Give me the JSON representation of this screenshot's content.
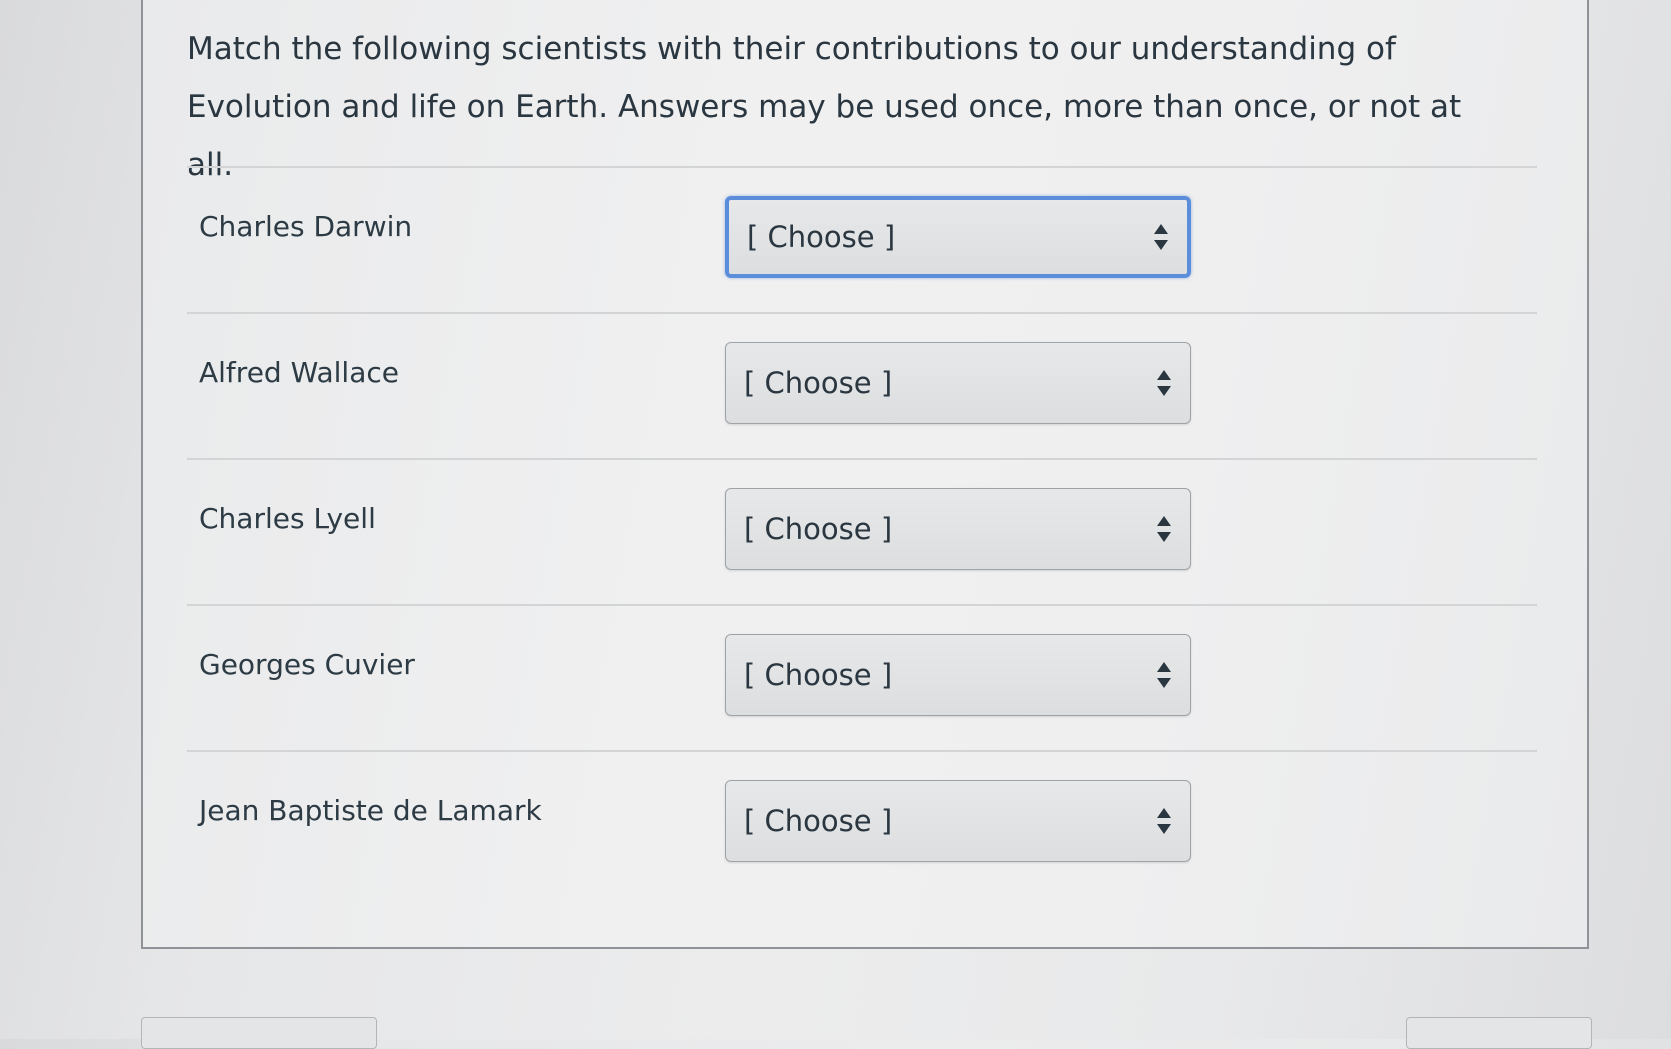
{
  "question": {
    "text": "Match the following scientists with their contributions to our understanding of Evolution and life on Earth.  Answers may be used once, more than once, or not at all."
  },
  "rows": [
    {
      "term": "Charles Darwin",
      "selected": "[ Choose ]"
    },
    {
      "term": "Alfred Wallace",
      "selected": "[ Choose ]"
    },
    {
      "term": "Charles Lyell",
      "selected": "[ Choose ]"
    },
    {
      "term": "Georges Cuvier",
      "selected": "[ Choose ]"
    },
    {
      "term": "Jean Baptiste de Lamark",
      "selected": "[ Choose ]"
    }
  ],
  "icons": {
    "select_arrow": "up-down-sort-icon"
  },
  "colors": {
    "focus_ring": "#5b8ddb",
    "text": "#2d3b45"
  }
}
